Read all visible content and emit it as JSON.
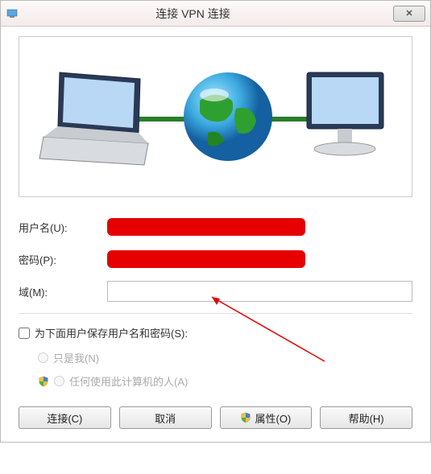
{
  "titlebar": {
    "title": "连接 VPN 连接"
  },
  "form": {
    "username_label": "用户名(U):",
    "password_label": "密码(P):",
    "domain_label": "域(M):",
    "domain_value": ""
  },
  "save": {
    "checkbox_label": "为下面用户保存用户名和密码(S):",
    "radio_me": "只是我(N)",
    "radio_anyone": "任何使用此计算机的人(A)"
  },
  "buttons": {
    "connect": "连接(C)",
    "cancel": "取消",
    "properties": "属性(O)",
    "help": "帮助(H)"
  }
}
